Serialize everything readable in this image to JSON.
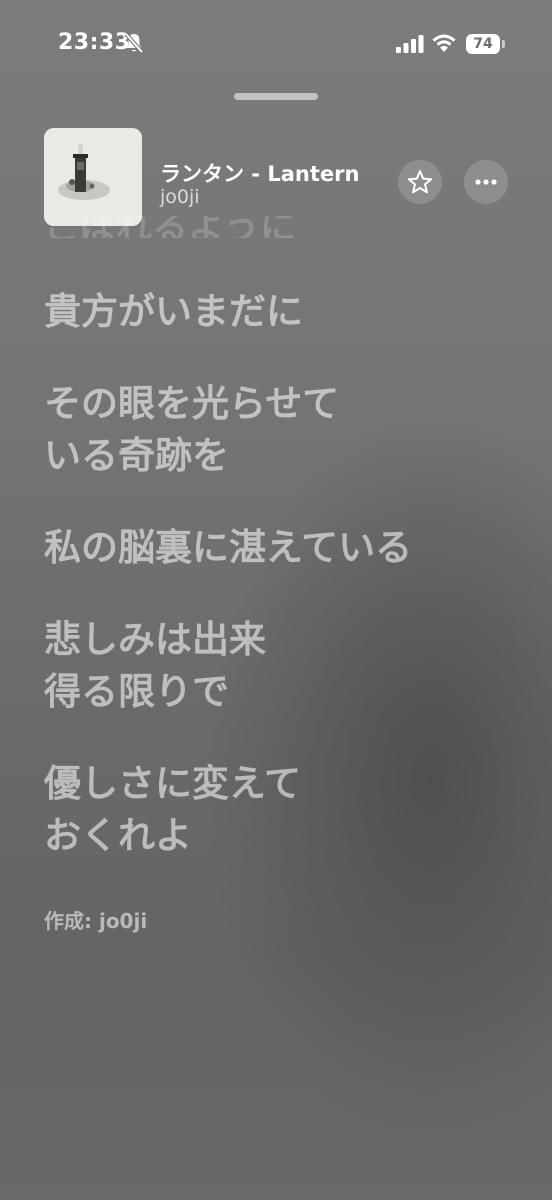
{
  "status_bar": {
    "time": "23:33",
    "battery_level": "74",
    "silent_mode": true
  },
  "now_playing": {
    "title": "ランタン - Lantern",
    "artist": "jo0ji",
    "artwork_icon": "album-artwork",
    "favorite_icon": "star-outline-icon",
    "more_icon": "ellipsis-icon"
  },
  "lyrics": {
    "previous_line_fragment": "こぼれるように",
    "lines": [
      [
        "貴方がいまだに"
      ],
      [
        "その眼を光らせて",
        "いる奇跡を"
      ],
      [
        "私の脳裏に湛えている"
      ],
      [
        "悲しみは出来",
        "得る限りで"
      ],
      [
        "優しさに変えて",
        "おくれよ"
      ]
    ],
    "credit": "作成: jo0ji"
  },
  "colors": {
    "background_top": "#7c7c7a",
    "background_bottom": "#646462",
    "lyric_text": "rgba(255,255,255,0.56)"
  }
}
